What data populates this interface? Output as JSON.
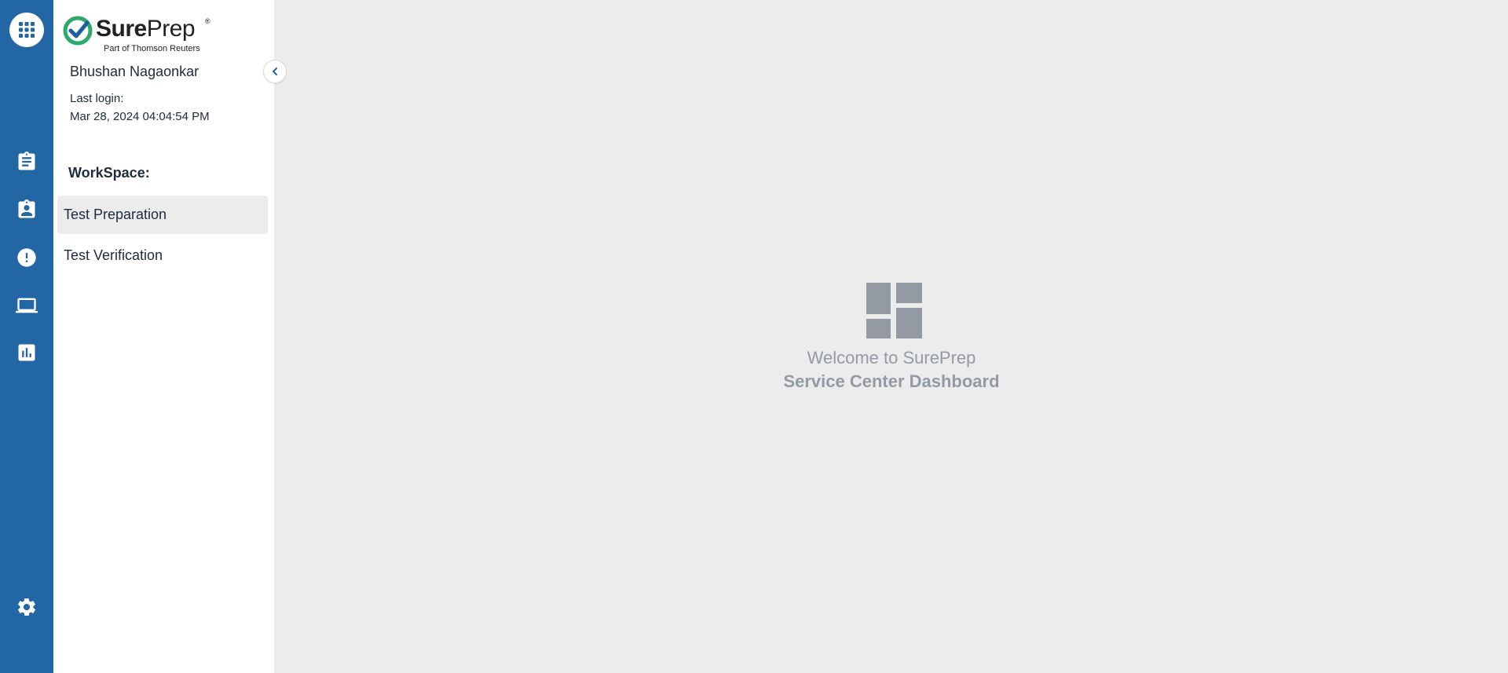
{
  "rail": {
    "icons": [
      "apps-grid-icon",
      "clipboard-icon",
      "assignment-user-icon",
      "alert-circle-icon",
      "laptop-icon",
      "bar-chart-icon",
      "settings-gear-icon"
    ]
  },
  "logo": {
    "brand_bold": "Sure",
    "brand_regular": "Prep",
    "registered": "®",
    "tagline": "Part of Thomson Reuters"
  },
  "user": {
    "name": "Bhushan Nagaonkar",
    "last_login_label": "Last login:",
    "last_login_value": "Mar 28, 2024 04:04:54 PM"
  },
  "workspace": {
    "label": "WorkSpace:",
    "items": [
      {
        "label": "Test Preparation",
        "active": true
      },
      {
        "label": "Test Verification",
        "active": false
      }
    ]
  },
  "main": {
    "welcome_line1": "Welcome to SurePrep",
    "welcome_line2": "Service Center Dashboard"
  },
  "colors": {
    "rail": "#2366a4",
    "panel": "#ffffff",
    "background": "#ececec",
    "muted_text": "#939aa3",
    "brand_green": "#2fa86b",
    "brand_blue": "#1d5fa1"
  }
}
